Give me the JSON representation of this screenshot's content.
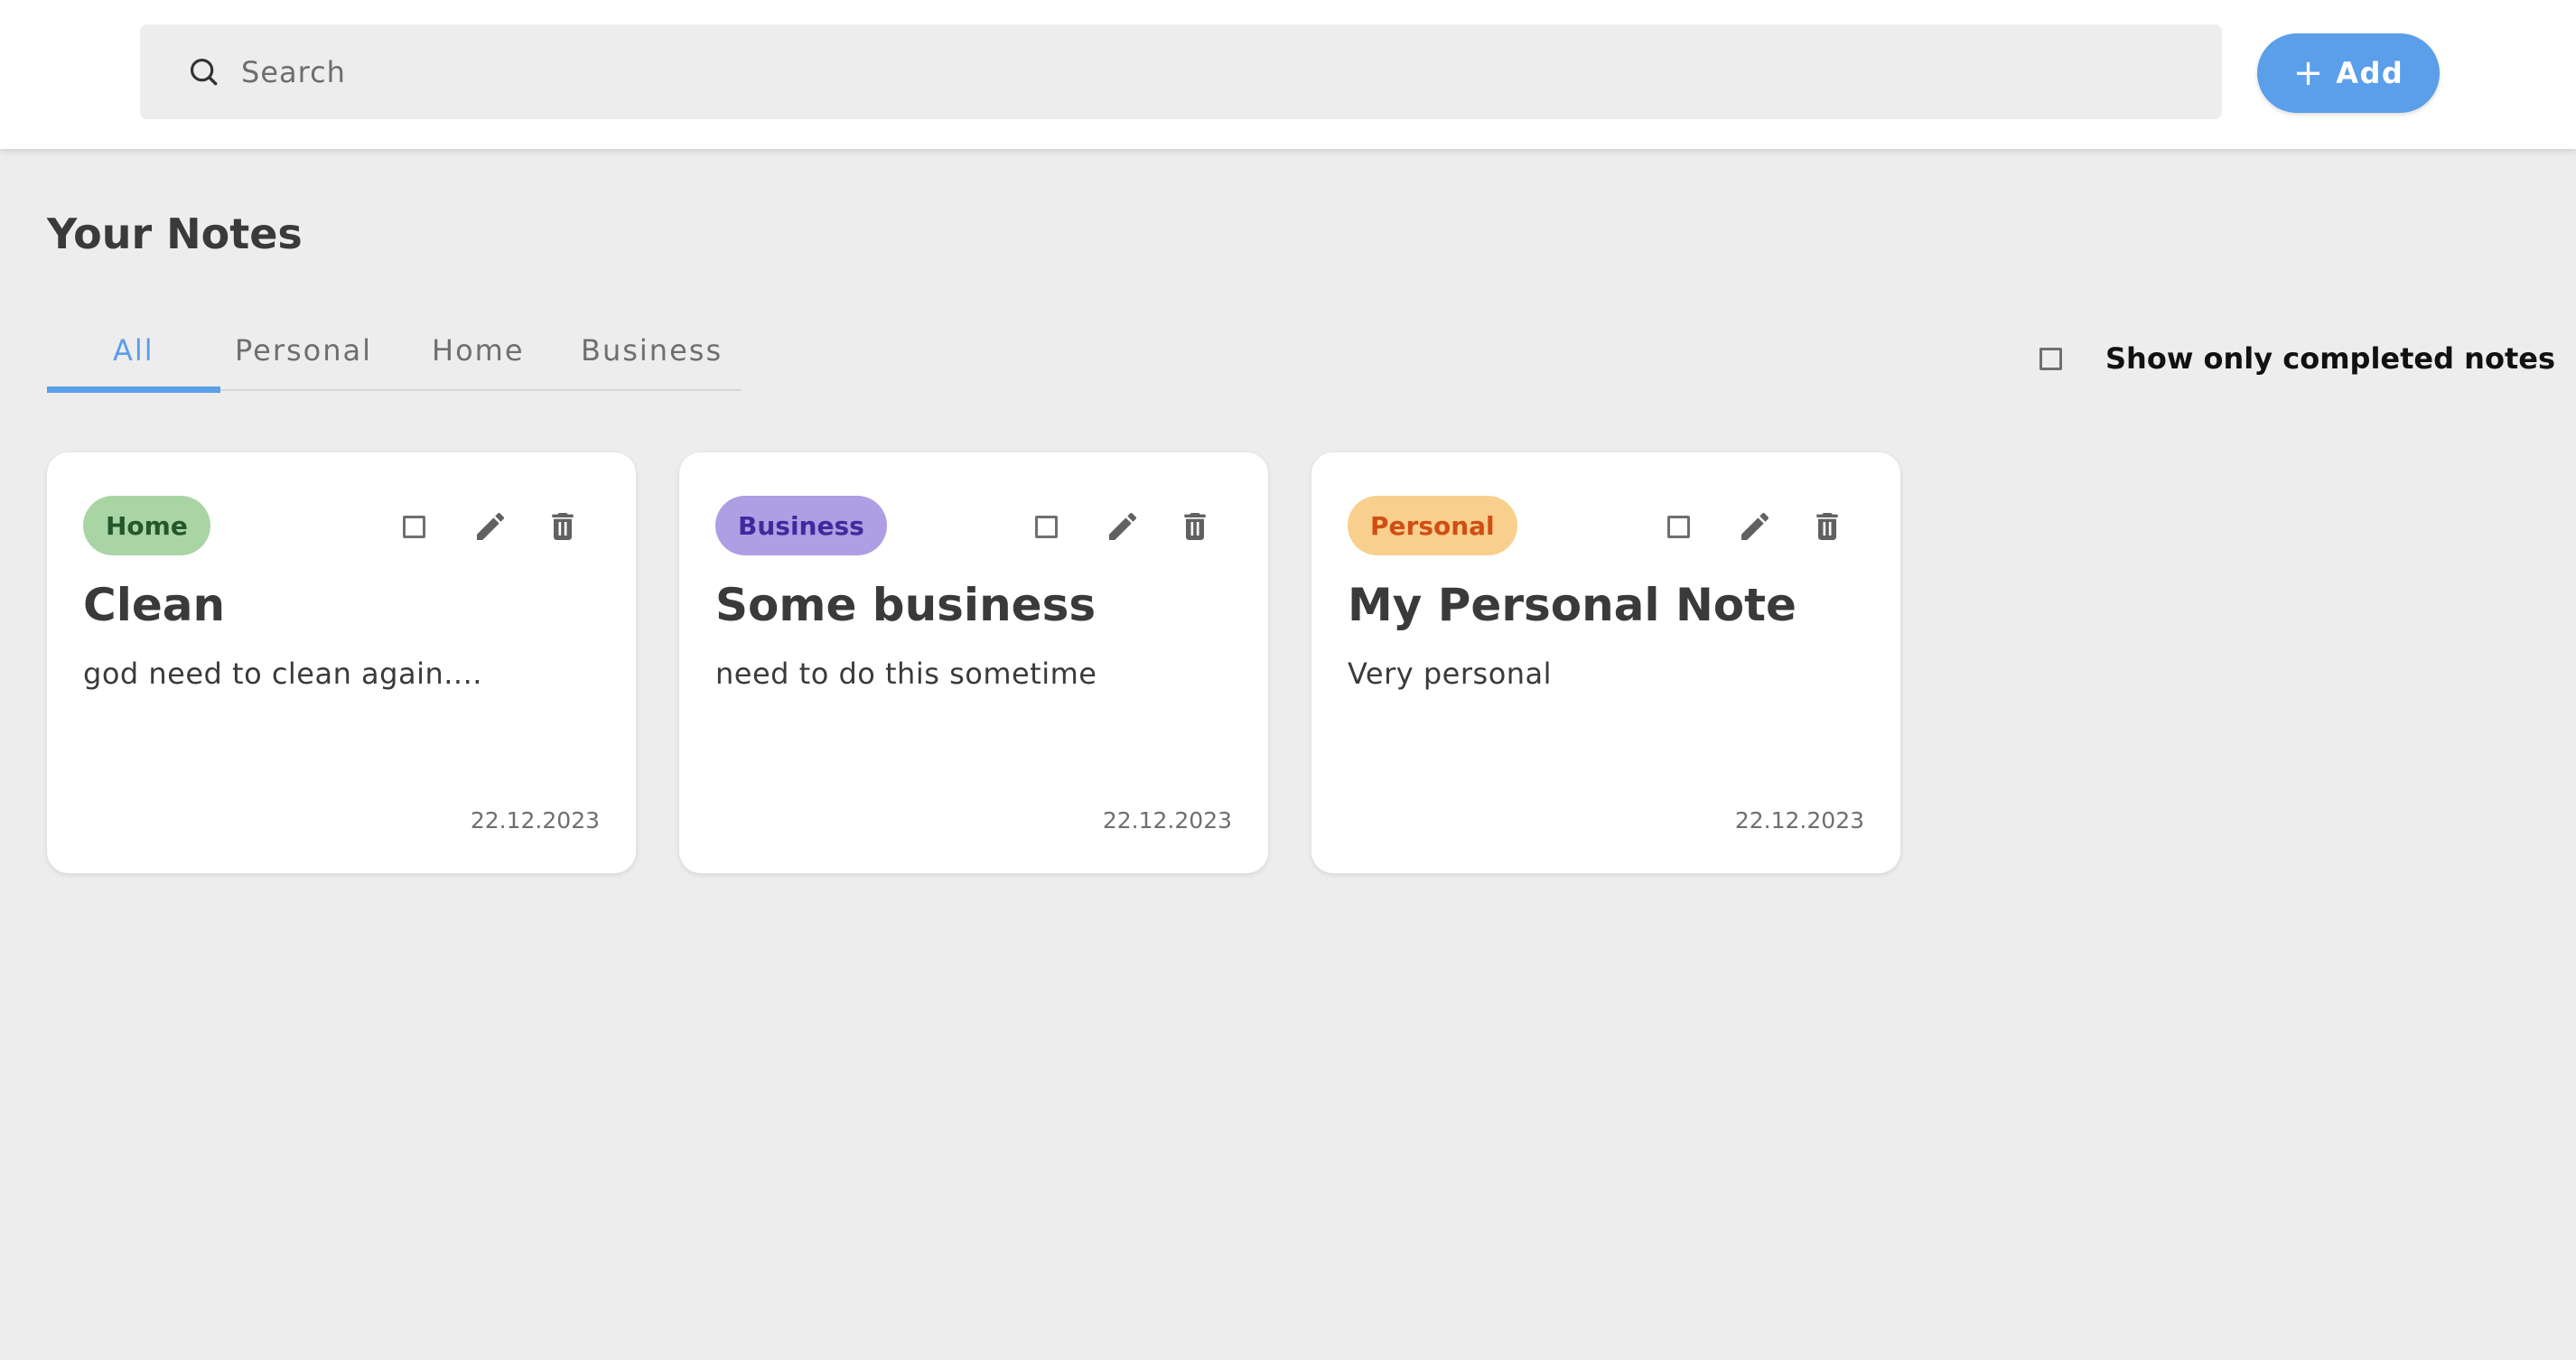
{
  "search": {
    "placeholder": "Search"
  },
  "add_button": {
    "label": "Add",
    "color": "#5b9ee9"
  },
  "page_title": "Your Notes",
  "tabs": [
    {
      "label": "All",
      "active": true
    },
    {
      "label": "Personal",
      "active": false
    },
    {
      "label": "Home",
      "active": false
    },
    {
      "label": "Business",
      "active": false
    }
  ],
  "filter": {
    "label": "Show only completed notes",
    "checked": false
  },
  "notes": [
    {
      "tag": "Home",
      "tag_bg": "#a9d5a4",
      "tag_color": "#24572b",
      "title": "Clean",
      "body": "god need to clean again....",
      "date": "22.12.2023",
      "completed": false
    },
    {
      "tag": "Business",
      "tag_bg": "#ae9ee3",
      "tag_color": "#3f2a9d",
      "title": "Some business",
      "body": "need to do this sometime",
      "date": "22.12.2023",
      "completed": false
    },
    {
      "tag": "Personal",
      "tag_bg": "#f8cf8c",
      "tag_color": "#d04e14",
      "title": "My Personal Note",
      "body": "Very personal",
      "date": "22.12.2023",
      "completed": false
    }
  ],
  "icons": {
    "search": "search-icon",
    "add": "plus-icon",
    "edit": "pencil-icon",
    "delete": "trash-icon"
  }
}
